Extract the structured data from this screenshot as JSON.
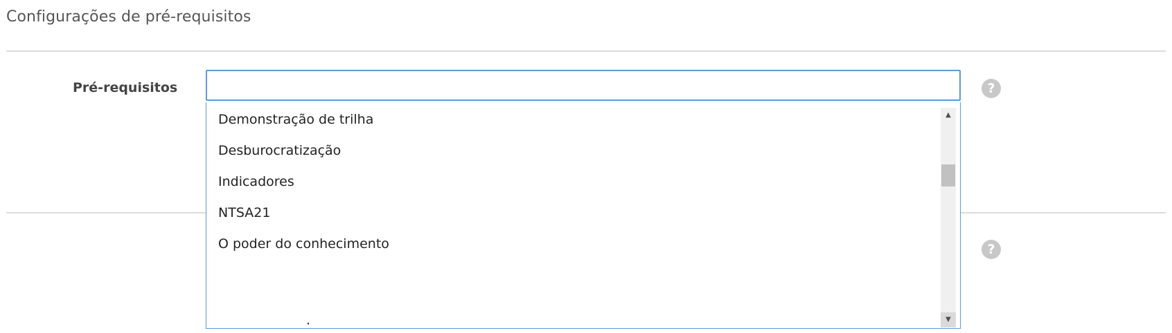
{
  "section": {
    "title": "Configurações de pré-requisitos"
  },
  "prerequisites_field": {
    "label": "Pré-requisitos",
    "input_value": ""
  },
  "dropdown": {
    "options": [
      "Demonstração de trilha",
      "Desburocratização",
      "Indicadores",
      "NTSA21",
      "O poder do conhecimento"
    ],
    "partial_option": "·"
  },
  "icons": {
    "help": "question-circle-icon",
    "scroll_up": "triangle-up-icon",
    "scroll_down": "triangle-down-icon"
  },
  "colors": {
    "focus_border": "#5b9bd5",
    "help_icon": "#c8c8c8",
    "divider": "#dcdcdc"
  }
}
